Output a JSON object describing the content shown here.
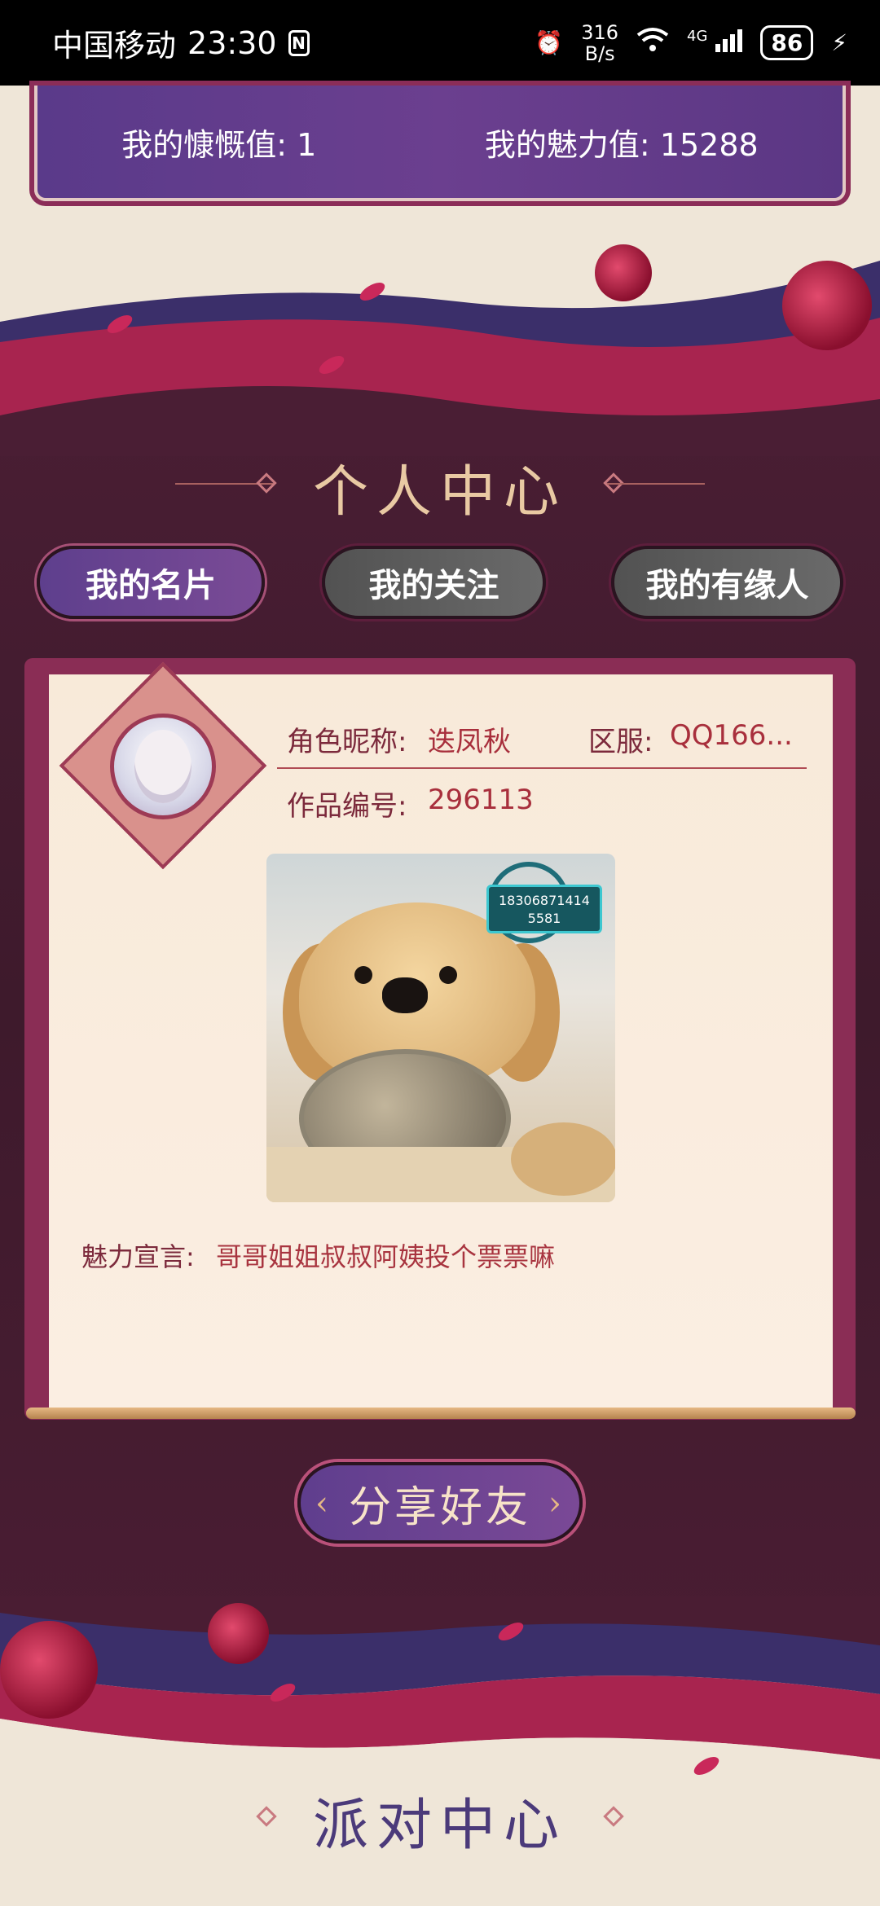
{
  "status_bar": {
    "carrier": "中国移动",
    "time": "23:30",
    "nfc": "N",
    "speed_value": "316",
    "speed_unit": "B/s",
    "network": "4G",
    "battery": "86"
  },
  "stats": {
    "generosity_label": "我的慷慨值:",
    "generosity_value": "1",
    "charm_label": "我的魅力值:",
    "charm_value": "15288"
  },
  "personal_center": {
    "title": "个人中心",
    "tabs": [
      {
        "label": "我的名片",
        "active": true
      },
      {
        "label": "我的关注",
        "active": false
      },
      {
        "label": "我的有缘人",
        "active": false
      }
    ]
  },
  "profile": {
    "nickname_label": "角色昵称:",
    "nickname_value": "迭凤秋",
    "server_label": "区服:",
    "server_value": "QQ166...",
    "work_id_label": "作品编号:",
    "work_id_value": "296113",
    "watermark_line1": "18306871414",
    "watermark_line2": "5581",
    "declaration_label": "魅力宣言:",
    "declaration_value": "哥哥姐姐叔叔阿姨投个票票嘛"
  },
  "share_button": {
    "label": "分享好友"
  },
  "party_center": {
    "title": "派对中心"
  },
  "colors": {
    "dark_bg": "#4a1e34",
    "accent_purple": "#6b3f8f",
    "gold": "#e9c9a3",
    "crimson": "#8a2d55"
  }
}
